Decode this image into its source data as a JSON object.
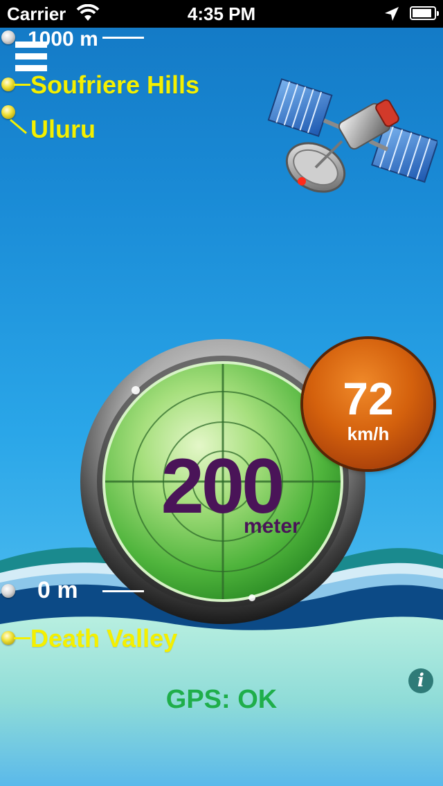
{
  "status_bar": {
    "carrier": "Carrier",
    "time": "4:35 PM",
    "battery_level": 0.9,
    "icons": [
      "wifi-icon",
      "location-arrow-icon",
      "battery-icon"
    ]
  },
  "scale": {
    "top_label": "1000 m",
    "bottom_label": "0 m"
  },
  "places": {
    "high": [
      "Soufriere Hills",
      "Uluru"
    ],
    "low": [
      "Death Valley"
    ]
  },
  "altitude": {
    "value": "200",
    "unit": "meter"
  },
  "speed": {
    "value": "72",
    "unit": "km/h"
  },
  "gps_status": "GPS: OK",
  "info_button": {
    "glyph": "i"
  },
  "colors": {
    "sky": "#1a8bd6",
    "place_label": "#f4f000",
    "altitude_text": "#4a1458",
    "gps_ok": "#1fae4a",
    "speed_orb": "#d4610d",
    "radar": "#5cc04a"
  }
}
